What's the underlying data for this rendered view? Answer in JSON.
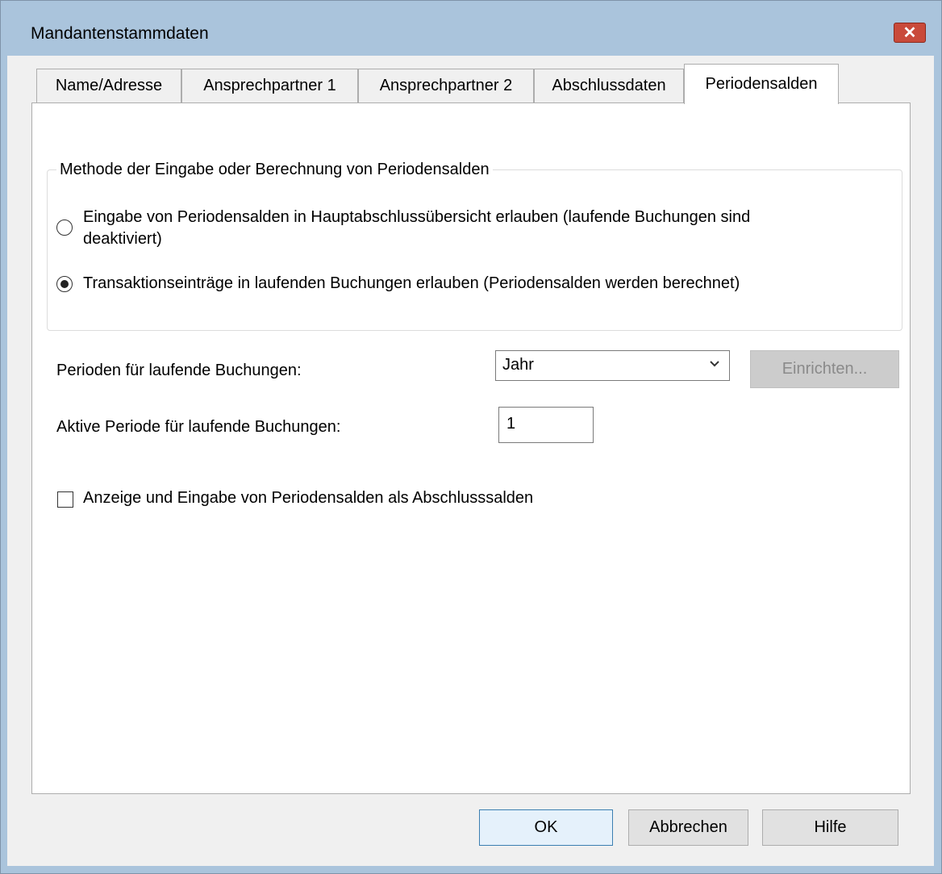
{
  "window": {
    "title": "Mandantenstammdaten",
    "close_icon": "close-icon"
  },
  "tabs": [
    {
      "label": "Name/Adresse",
      "active": false
    },
    {
      "label": "Ansprechpartner 1",
      "active": false
    },
    {
      "label": "Ansprechpartner 2",
      "active": false
    },
    {
      "label": "Abschlussdaten",
      "active": false
    },
    {
      "label": "Periodensalden",
      "active": true
    }
  ],
  "method_group": {
    "legend": "Methode der Eingabe oder Berechnung von Periodensalden",
    "options": [
      {
        "line1": "Eingabe von Periodensalden in Hauptabschlussübersicht erlauben (laufende Buchungen sind",
        "line2": "deaktiviert)",
        "selected": false
      },
      {
        "line1": "Transaktionseinträge in laufenden Buchungen erlauben (Periodensalden werden berechnet)",
        "selected": true
      }
    ]
  },
  "periods": {
    "label": "Perioden für laufende Buchungen:",
    "selected_value": "Jahr",
    "setup_button": "Einrichten..."
  },
  "active_period": {
    "label": "Aktive Periode für laufende Buchungen:",
    "value": "1"
  },
  "checkbox": {
    "label": "Anzeige und Eingabe von Periodensalden als Abschlusssalden",
    "checked": false
  },
  "buttons": {
    "ok": "OK",
    "cancel": "Abbrechen",
    "help": "Hilfe"
  }
}
